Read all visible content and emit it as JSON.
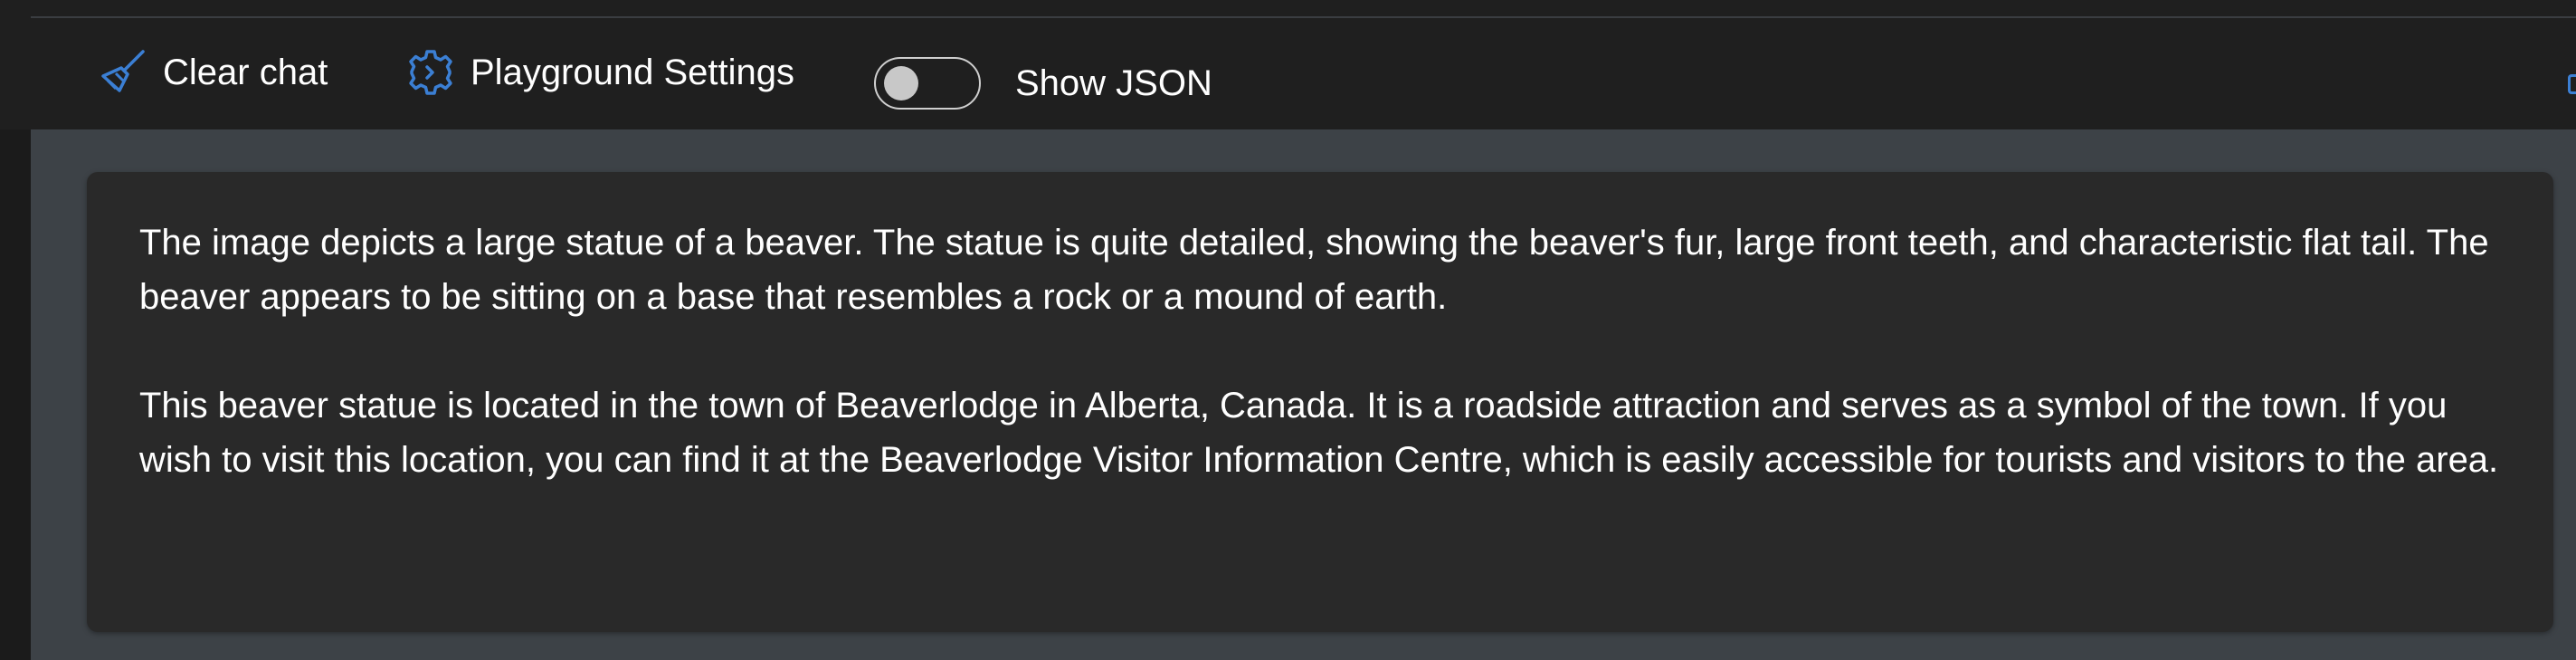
{
  "toolbar": {
    "clear_chat_label": "Clear chat",
    "playground_settings_label": "Playground Settings",
    "show_json_label": "Show JSON",
    "show_json_enabled": false
  },
  "icons": {
    "clear_chat": "broom-icon",
    "playground_settings": "gear-icon"
  },
  "message": {
    "paragraphs": [
      "The image depicts a large statue of a beaver. The statue is quite detailed, showing the beaver's fur, large front teeth, and characteristic flat tail. The beaver appears to be sitting on a base that resembles a rock or a mound of earth.",
      "This beaver statue is located in the town of Beaverlodge in Alberta, Canada. It is a roadside attraction and serves as a symbol of the town. If you wish to visit this location, you can find it at the Beaverlodge Visitor Information Centre, which is easily accessible for tourists and visitors to the area."
    ]
  },
  "colors": {
    "accent": "#3b7fd4",
    "toolbar_bg": "#1f1f1f",
    "chat_area_bg": "#3d4247",
    "card_bg": "#292929",
    "text": "#ffffff"
  }
}
